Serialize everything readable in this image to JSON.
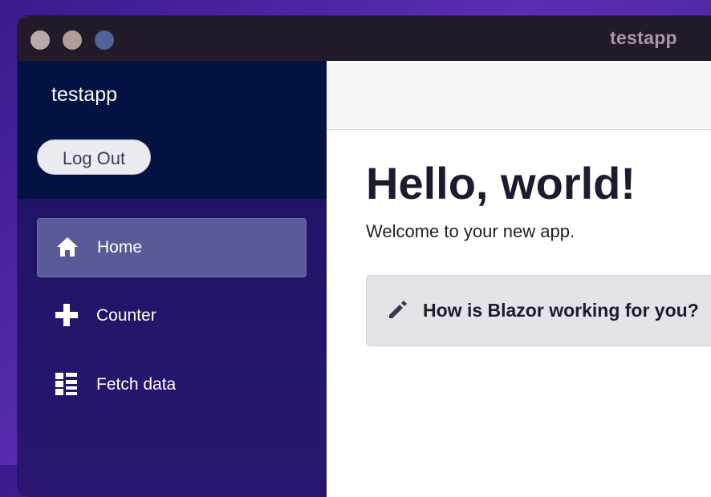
{
  "window": {
    "title": "testapp"
  },
  "sidebar": {
    "brand": "testapp",
    "logout_label": "Log Out",
    "items": [
      {
        "label": "Home",
        "icon": "home-icon",
        "active": true
      },
      {
        "label": "Counter",
        "icon": "plus-icon",
        "active": false
      },
      {
        "label": "Fetch data",
        "icon": "list-icon",
        "active": false
      }
    ]
  },
  "main": {
    "heading": "Hello, world!",
    "welcome": "Welcome to your new app.",
    "survey_prompt": "How is Blazor working for you?",
    "survey_icon": "pencil-icon"
  },
  "colors": {
    "sidebar_top": "#031243",
    "sidebar": "#1c1260",
    "active_item": "#5a5a99",
    "title_bar": "#221a28"
  }
}
